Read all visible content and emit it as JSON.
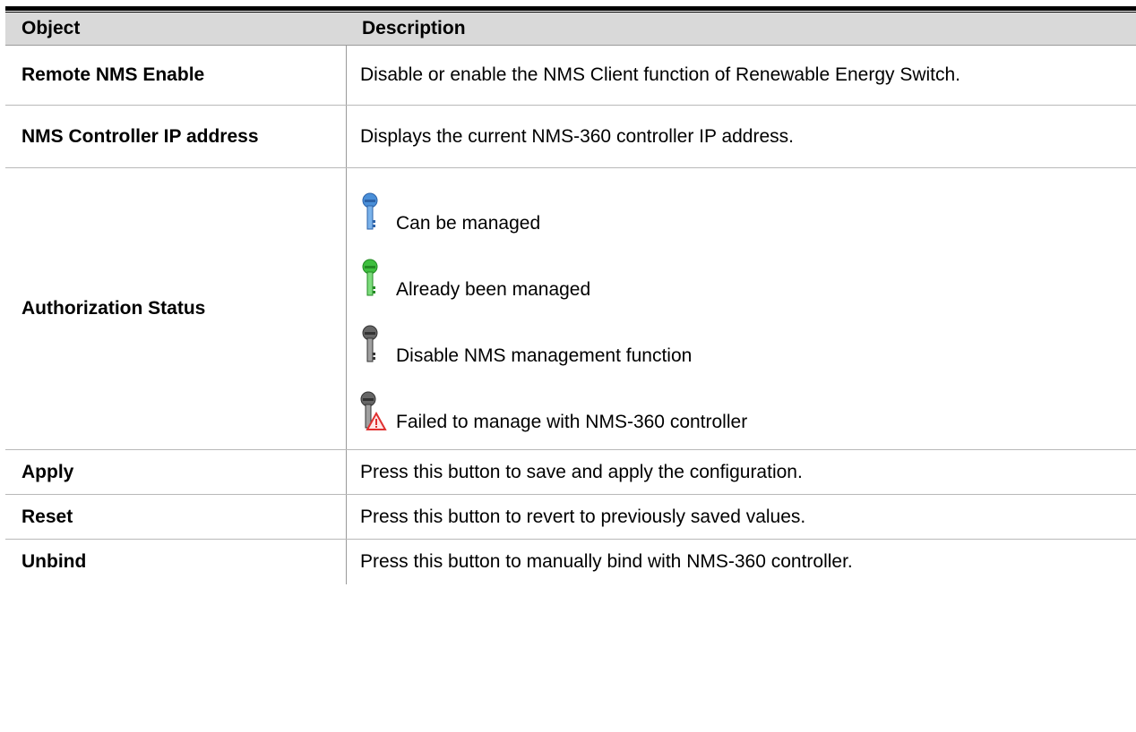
{
  "table": {
    "header": {
      "object": "Object",
      "description": "Description"
    },
    "rows": [
      {
        "object": "Remote NMS Enable",
        "description": "Disable or enable the NMS Client function of Renewable Energy Switch."
      },
      {
        "object": "NMS Controller IP address",
        "description": "Displays the current NMS-360 controller IP address."
      },
      {
        "object": "Authorization Status",
        "status_items": [
          {
            "icon": "blue-key-icon",
            "color": "#4a8fd8",
            "label": "Can be managed"
          },
          {
            "icon": "green-key-icon",
            "color": "#3fbf3f",
            "label": "Already been managed"
          },
          {
            "icon": "gray-key-icon",
            "color": "#666666",
            "label": "Disable NMS management function"
          },
          {
            "icon": "gray-key-warning-icon",
            "color": "#666666",
            "warning_color": "#e03030",
            "label": "Failed to manage with NMS-360 controller"
          }
        ]
      },
      {
        "object": "Apply",
        "description": "Press this button to save and apply the configuration."
      },
      {
        "object": "Reset",
        "description": "Press this button to revert to previously saved values."
      },
      {
        "object": "Unbind",
        "description": "Press this button to manually bind with NMS-360 controller."
      }
    ]
  }
}
